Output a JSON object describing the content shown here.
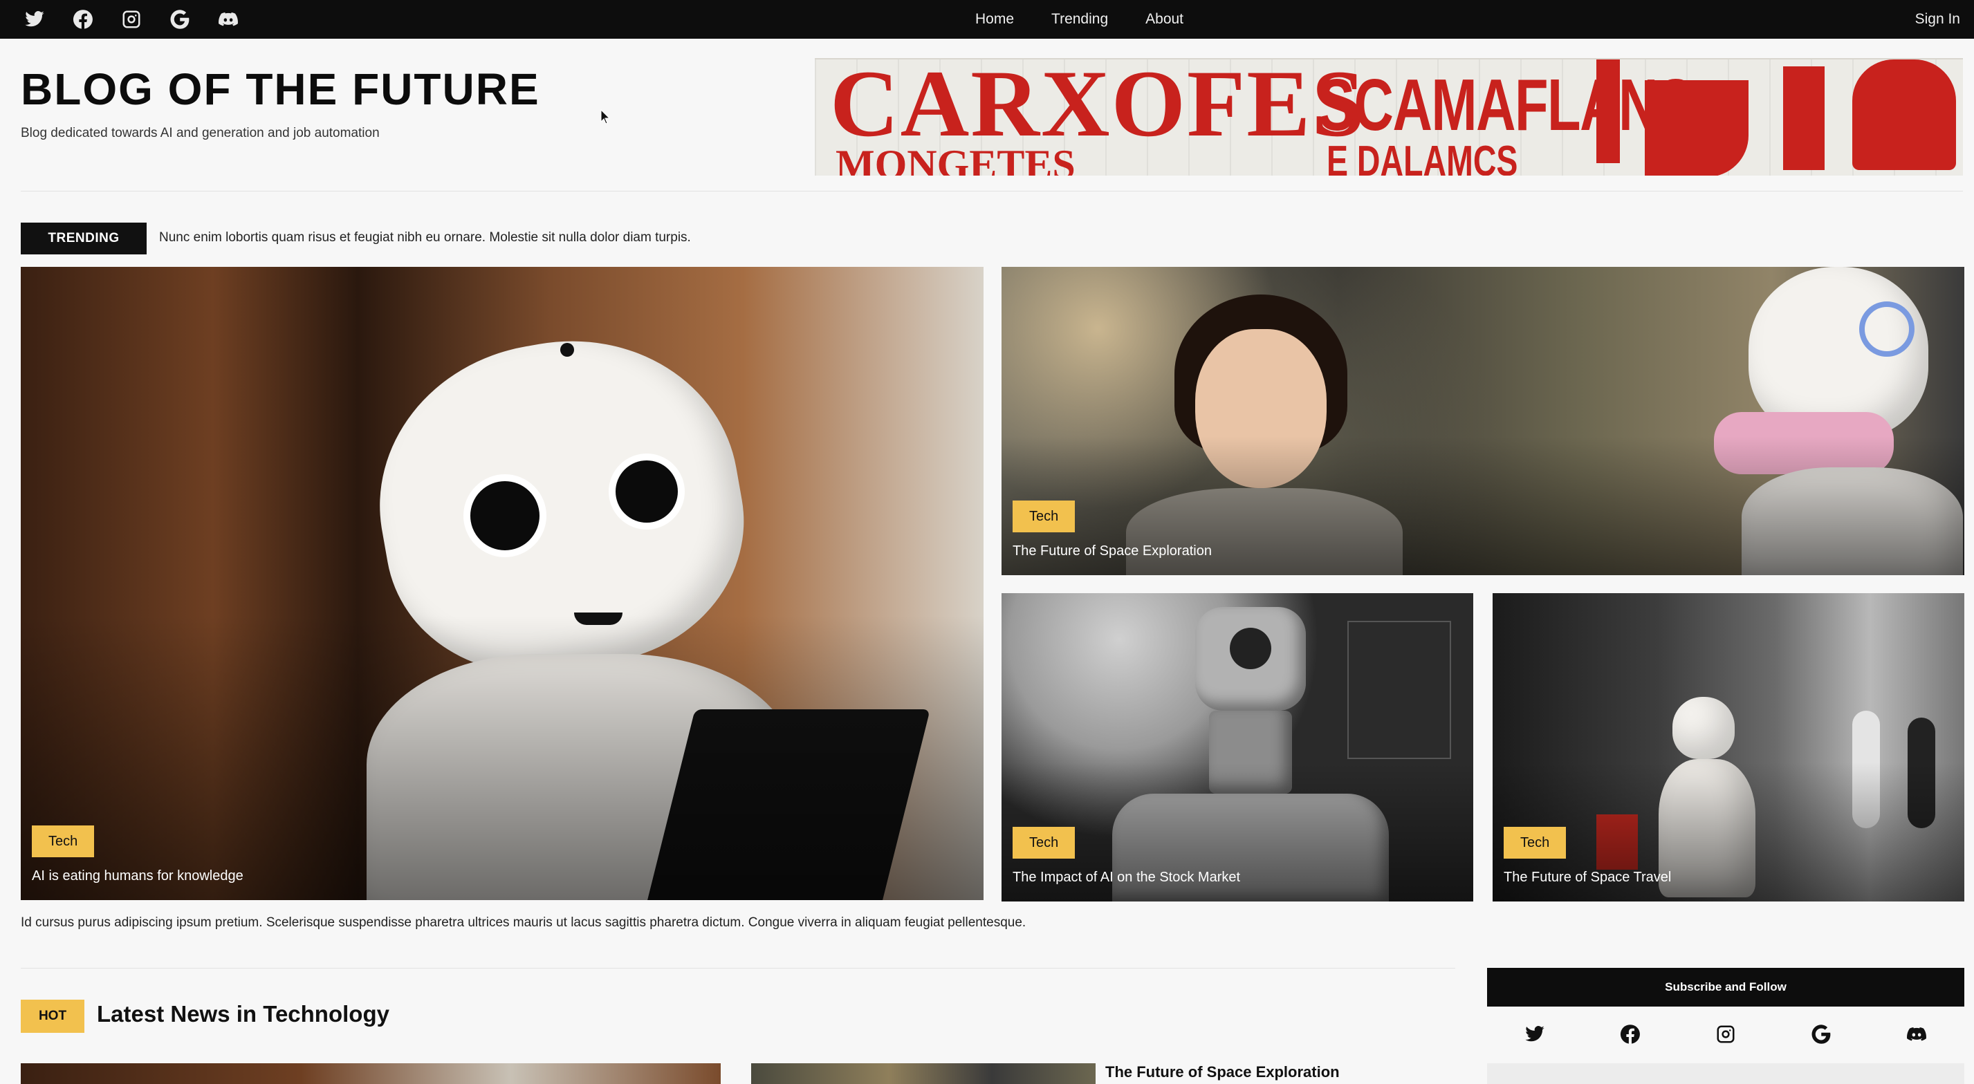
{
  "nav": {
    "social_icons": [
      "twitter-icon",
      "facebook-icon",
      "instagram-icon",
      "google-icon",
      "discord-icon"
    ],
    "menu": [
      "Home",
      "Trending",
      "About"
    ],
    "signin": "Sign In"
  },
  "header": {
    "title": "BLOG OF THE FUTURE",
    "tagline": "Blog dedicated towards AI and generation and job automation"
  },
  "banner": {
    "line1": "CARXOFES",
    "line2": "SCAMAFLANS",
    "line3": "MONGETES",
    "line4": "E DALAMCS"
  },
  "trending": {
    "label": "TRENDING",
    "text": "Nunc enim lobortis quam risus et feugiat nibh eu ornare. Molestie sit nulla dolor diam turpis."
  },
  "grid": {
    "cards": [
      {
        "category": "Tech",
        "title": "AI is eating humans for knowledge"
      },
      {
        "category": "Tech",
        "title": "The Future of Space Exploration"
      },
      {
        "category": "Tech",
        "title": "The Impact of AI on the Stock Market"
      },
      {
        "category": "Tech",
        "title": "The Future of Space Travel"
      }
    ],
    "note": "Id cursus purus adipiscing ipsum pretium. Scelerisque suspendisse pharetra ultrices mauris ut lacus sagittis pharetra dictum. Congue viverra in aliquam feugiat pellentesque."
  },
  "latest": {
    "tag": "HOT",
    "title": "Latest News in Technology",
    "headline": "The Future of Space Exploration"
  },
  "sidebar": {
    "heading": "Subscribe and Follow",
    "icons": [
      "twitter-icon",
      "facebook-icon",
      "instagram-icon",
      "google-icon",
      "discord-icon"
    ]
  },
  "colors": {
    "nav_bg": "#0d0d0d",
    "accent_yellow": "#f2c14e",
    "banner_red": "#c8221d"
  }
}
